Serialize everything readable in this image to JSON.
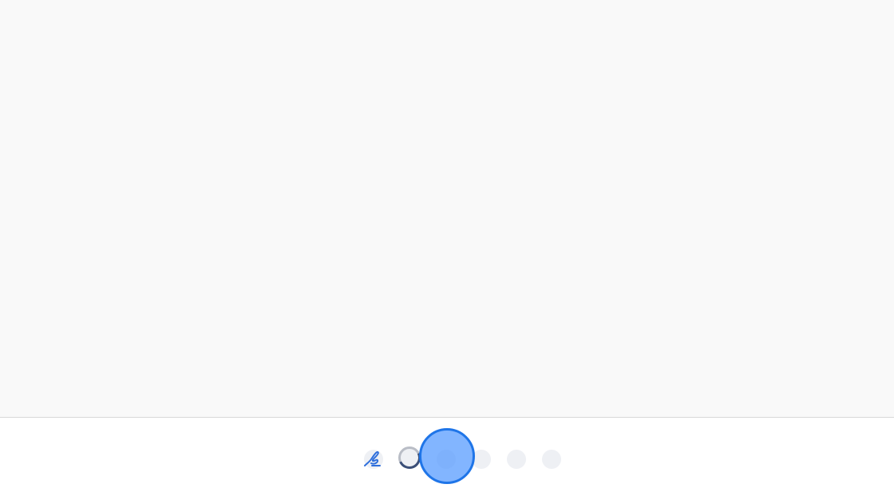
{
  "canvas": {
    "background": "#f9f9f9"
  },
  "toolbar": {
    "tools": [
      {
        "icon": "signature-icon",
        "color": "#2f6fdc"
      },
      {
        "icon": "loading-spinner-icon"
      },
      {
        "icon": "tool-dot-icon"
      },
      {
        "icon": "tool-dot-icon"
      },
      {
        "icon": "tool-dot-icon"
      },
      {
        "icon": "tool-dot-icon"
      }
    ]
  },
  "touch_indicator": {
    "color": "#5a9cff",
    "border_color": "#1f75e8"
  }
}
